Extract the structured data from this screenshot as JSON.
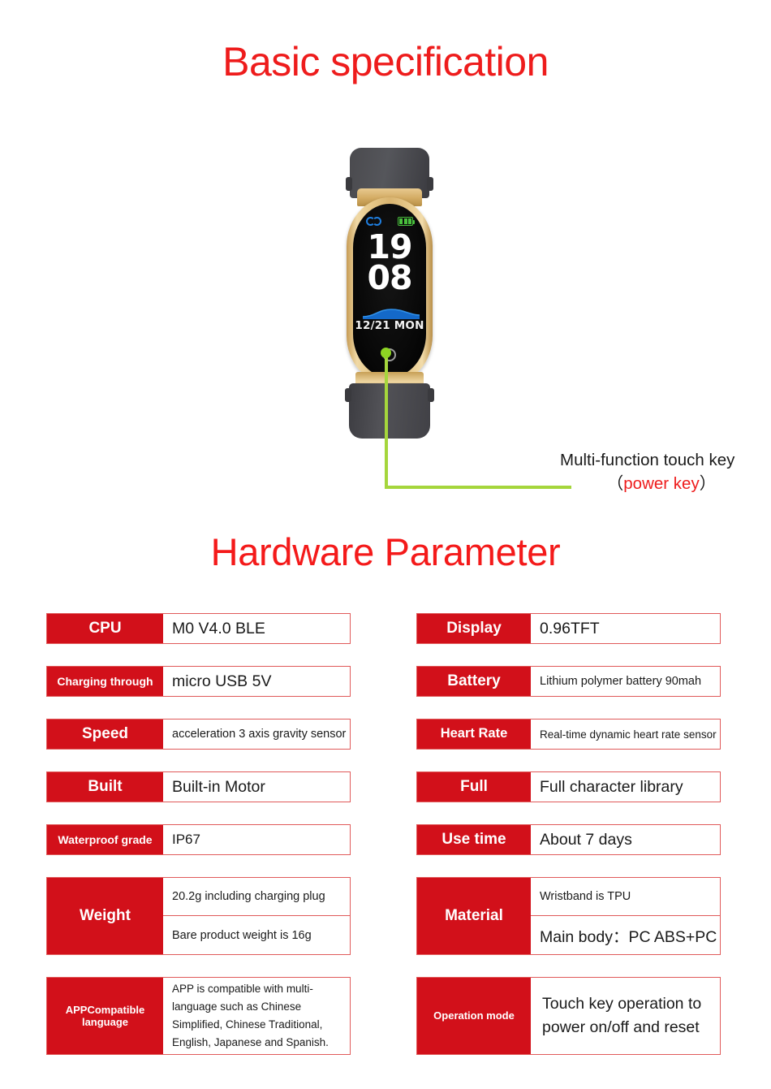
{
  "titles": {
    "basic": "Basic specification",
    "hardware": "Hardware Parameter"
  },
  "watch": {
    "time_hour": "19",
    "time_minute": "08",
    "date": "12/21 MON",
    "bluetooth_icon": "bluetooth-icon",
    "battery_icon": "battery-icon",
    "touch_key_icon": "touch-key-circle-icon"
  },
  "callout": {
    "line1": "Multi-function touch key",
    "paren_open": "（",
    "highlight": "power key",
    "paren_close": "）"
  },
  "colors": {
    "title_red": "#ee1c1c",
    "label_red": "#d2101a",
    "border_red": "#e05a5a",
    "callout_green": "#a5d63c",
    "screen_blue": "#1f7fe0",
    "battery_green": "#49bf3d"
  },
  "specs": {
    "left": [
      {
        "label": "CPU",
        "value": "M0  V4.0 BLE"
      },
      {
        "label": "Charging through",
        "value": "micro USB 5V"
      },
      {
        "label": "Speed",
        "value": "acceleration 3 axis gravity sensor"
      },
      {
        "label": "Built",
        "value": "Built-in Motor"
      },
      {
        "label": "Waterproof grade",
        "value": "IP67"
      },
      {
        "label": "Weight",
        "value_a": "20.2g including charging plug",
        "value_b": "Bare product weight is 16g"
      },
      {
        "label_a": "APPCompatible",
        "label_b": "language",
        "value": "APP is compatible with multi-language such as Chinese Simplified, Chinese Traditional, English, Japanese and Spanish."
      }
    ],
    "right": [
      {
        "label": "Display",
        "value": "0.96TFT"
      },
      {
        "label": "Battery",
        "value": "Lithium polymer battery 90mah"
      },
      {
        "label": "Heart Rate",
        "value": "Real-time dynamic heart rate sensor"
      },
      {
        "label": "Full",
        "value": "Full character library"
      },
      {
        "label": "Use time",
        "value": "About 7 days"
      },
      {
        "label": "Material",
        "value_a": "Wristband is TPU",
        "value_b": "Main body：PC  ABS+PC"
      },
      {
        "label": "Operation mode",
        "value_a": "Touch key operation to",
        "value_b": "power on/off and reset"
      }
    ]
  }
}
